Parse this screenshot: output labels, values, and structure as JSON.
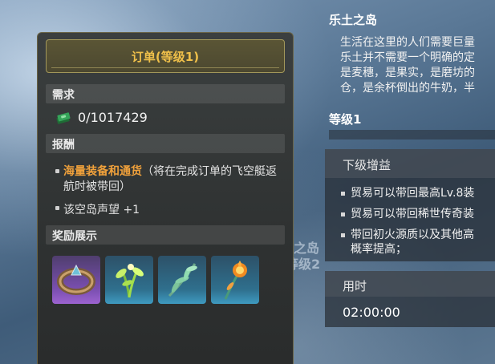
{
  "background": {
    "island_name": "林之岛",
    "island_level": "等级2"
  },
  "order_panel": {
    "title": "订单(等级1)",
    "requirement": {
      "header": "需求",
      "icon": "cash-stack-icon",
      "value": "0/1017429"
    },
    "rewards": {
      "header": "报酬",
      "items": [
        {
          "highlight": "海量装备和通货",
          "text": "（将在完成订单的飞空艇返航时被带回）"
        },
        {
          "highlight": "",
          "text": "该空岛声望 +1"
        }
      ]
    },
    "showcase": {
      "header": "奖励展示",
      "items": [
        {
          "icon": "ring-icon",
          "rarity": "purple"
        },
        {
          "icon": "glowing-herb-icon",
          "rarity": "blue"
        },
        {
          "icon": "fern-leaf-icon",
          "rarity": "blue"
        },
        {
          "icon": "fire-flower-icon",
          "rarity": "blue"
        }
      ]
    }
  },
  "info_panel": {
    "title": "乐土之岛",
    "description_lines": [
      "生活在这里的人们需要巨量",
      "乐土并不需要一个明确的定",
      "是麦穗，是果实，是磨坊的",
      "仓，是余杯倒出的牛奶，半"
    ],
    "level_label": "等级1",
    "next_bonus": {
      "header": "下级增益",
      "items": [
        "贸易可以带回最高Lv.8装",
        "贸易可以带回稀世传奇装",
        "带回初火源质以及其他高",
        "概率提高；"
      ]
    },
    "time": {
      "header": "用时",
      "value": "02:00:00"
    }
  },
  "colors": {
    "title_gold": "#f0c04a",
    "highlight_orange": "#f0a13b",
    "panel_bg": "#323535",
    "purple_rarity": "#8a57c0",
    "blue_rarity": "#3487ad"
  }
}
